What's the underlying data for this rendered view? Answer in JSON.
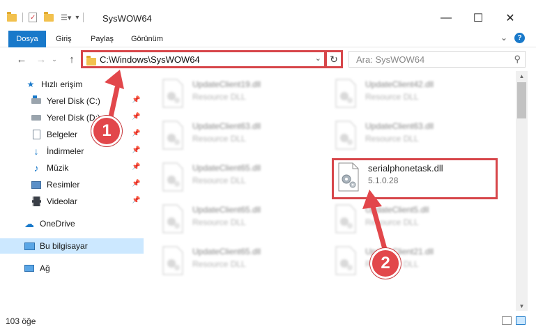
{
  "window": {
    "title": "SysWOW64",
    "minimize_glyph": "—",
    "maximize_glyph": "☐",
    "close_glyph": "✕"
  },
  "ribbon": {
    "tabs": [
      "Dosya",
      "Giriş",
      "Paylaş",
      "Görünüm"
    ],
    "expand_glyph": "⌄",
    "help_glyph": "?"
  },
  "address": {
    "path": "C:\\Windows\\SysWOW64",
    "search_placeholder": "Ara: SysWOW64"
  },
  "nav": {
    "quick_access": "Hızlı erişim",
    "items": [
      {
        "label": "Yerel Disk (C:)",
        "icon": "drive-icon"
      },
      {
        "label": "Yerel Disk (D:)",
        "icon": "drive-icon"
      },
      {
        "label": "Belgeler",
        "icon": "documents-icon"
      },
      {
        "label": "İndirmeler",
        "icon": "downloads-icon"
      },
      {
        "label": "Müzik",
        "icon": "music-icon"
      },
      {
        "label": "Resimler",
        "icon": "pictures-icon"
      },
      {
        "label": "Videolar",
        "icon": "videos-icon"
      }
    ],
    "onedrive": "OneDrive",
    "this_pc": "Bu bilgisayar",
    "network": "Ağ"
  },
  "files": {
    "left": [
      {
        "name": "UpdateClient19.dll",
        "sub": "Resource DLL"
      },
      {
        "name": "UpdateClient63.dll",
        "sub": "Resource DLL"
      },
      {
        "name": "UpdateClient65.dll",
        "sub": "Resource DLL"
      },
      {
        "name": "UpdateClient65.dll",
        "sub": "Resource DLL"
      },
      {
        "name": "UpdateClient65.dll",
        "sub": "Resource DLL"
      }
    ],
    "right": [
      {
        "name": "UpdateClient42.dll",
        "sub": "Resource DLL"
      },
      {
        "name": "UpdateClient63.dll",
        "sub": "Resource DLL"
      },
      {
        "name": "serialphonetask.dll",
        "sub": "5.1.0.28"
      },
      {
        "name": "UpdateClient5.dll",
        "sub": "Resource DLL"
      },
      {
        "name": "UpdateClient21.dll",
        "sub": "Resource DLL"
      }
    ]
  },
  "status": {
    "item_count": "103 öğe"
  },
  "annotations": {
    "marker1": "1",
    "marker2": "2",
    "color": "#e2474b"
  }
}
